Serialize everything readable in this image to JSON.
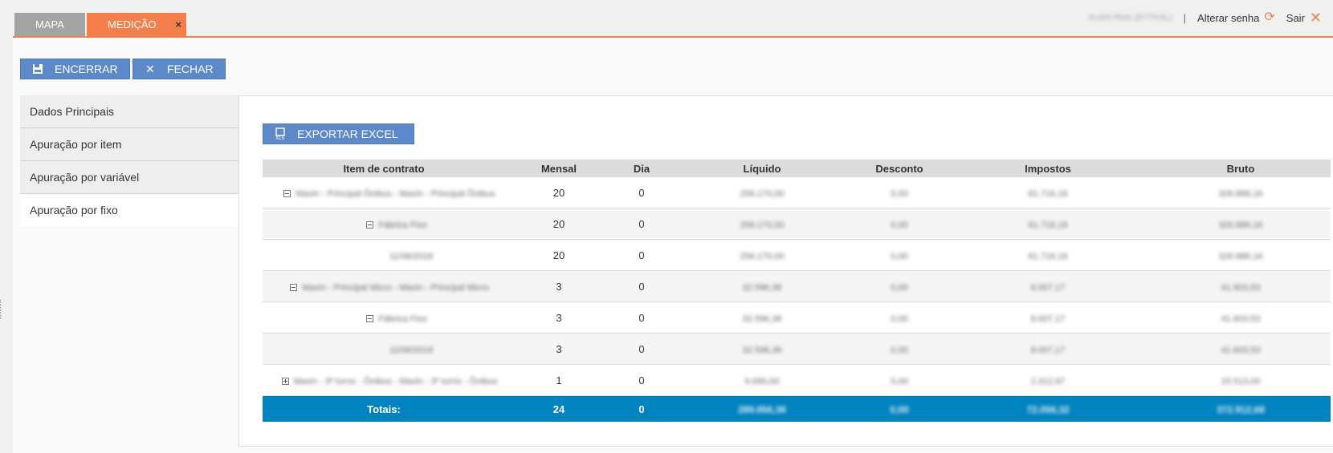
{
  "tabs": [
    {
      "label": "MAPA",
      "active": false
    },
    {
      "label": "MEDIÇÃO",
      "active": true,
      "close_icon": "×"
    }
  ],
  "user": {
    "name": "André Reis (B7TK6L)",
    "separator": "|",
    "change_password_label": "Alterar senha",
    "logout_label": "Sair"
  },
  "toolbar": {
    "close_measure_label": "ENCERRAR",
    "close_label": "FECHAR"
  },
  "sidebar": {
    "items": [
      {
        "label": "Dados Principais"
      },
      {
        "label": "Apuração por item"
      },
      {
        "label": "Apuração por variável"
      },
      {
        "label": "Apuração por fixo"
      }
    ]
  },
  "export": {
    "label": "EXPORTAR EXCEL"
  },
  "table": {
    "headers": [
      "Item de contrato",
      "Mensal",
      "Dia",
      "Líquido",
      "Desconto",
      "Impostos",
      "Bruto"
    ],
    "rows": [
      {
        "item": "Mavin - Principal Ônibus - Mavin - Principal Ônibus",
        "mensal": "20",
        "dia": "0",
        "liquido": "256.170,00",
        "desconto": "0,00",
        "impostos": "61.716,16",
        "bruto": "326.886,16"
      },
      {
        "item": "Fábrica Fixo",
        "mensal": "20",
        "dia": "0",
        "liquido": "256.170,00",
        "desconto": "0,00",
        "impostos": "61.716,16",
        "bruto": "326.886,16"
      },
      {
        "item": "11/06/2018",
        "mensal": "20",
        "dia": "0",
        "liquido": "256.170,00",
        "desconto": "0,00",
        "impostos": "61.716,16",
        "bruto": "326.886,16"
      },
      {
        "item": "Mavin - Principal Micro - Mavin - Principal Micro",
        "mensal": "3",
        "dia": "0",
        "liquido": "32.596,36",
        "desconto": "0,00",
        "impostos": "8.007,17",
        "bruto": "41.603,53"
      },
      {
        "item": "Fábrica Fixo",
        "mensal": "3",
        "dia": "0",
        "liquido": "32.596,36",
        "desconto": "0,00",
        "impostos": "8.007,17",
        "bruto": "41.603,53"
      },
      {
        "item": "11/06/2018",
        "mensal": "3",
        "dia": "0",
        "liquido": "32.596,36",
        "desconto": "0,00",
        "impostos": "8.007,17",
        "bruto": "41.603,53"
      },
      {
        "item": "Mavin - 3º turno - Ônibus - Mavin - 3º turno - Ônibus",
        "mensal": "1",
        "dia": "0",
        "liquido": "6.690,00",
        "desconto": "0,00",
        "impostos": "2.312,97",
        "bruto": "15.513,00"
      }
    ],
    "totals": {
      "label": "Totais:",
      "mensal": "24",
      "dia": "0",
      "liquido": "289.856,36",
      "desconto": "0,00",
      "impostos": "72.056,32",
      "bruto": "372.912,68"
    }
  }
}
